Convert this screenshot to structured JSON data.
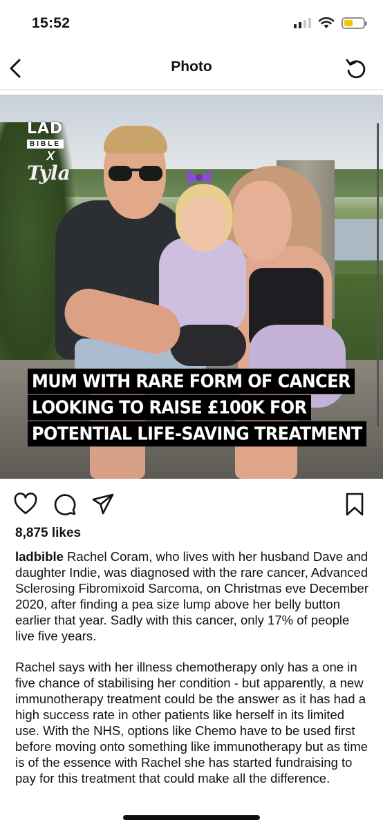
{
  "status_bar": {
    "time": "15:52",
    "battery_level": 0.45,
    "battery_color": "#f6c700",
    "signal_bars": 2
  },
  "nav": {
    "title": "Photo",
    "back_icon": "chevron-left-icon",
    "refresh_icon": "refresh-icon"
  },
  "post": {
    "image": {
      "logo": {
        "lad": "LAD",
        "bible": "BIBLE",
        "x": "X",
        "tyla": "Tyla"
      },
      "headline": [
        "MUM WITH RARE FORM OF CANCER",
        "LOOKING TO RAISE £100K FOR",
        "POTENTIAL LIFE-SAVING TREATMENT"
      ]
    },
    "actions": {
      "like_icon": "heart-icon",
      "comment_icon": "comment-icon",
      "share_icon": "send-icon",
      "save_icon": "bookmark-icon"
    },
    "likes": "8,875 likes",
    "username": "ladbible",
    "caption_p1": "Rachel Coram, who lives with her husband Dave and daughter Indie, was diagnosed with the rare cancer, Advanced Sclerosing Fibromixoid Sarcoma, on Christmas eve December 2020, after finding a pea size lump above her belly button earlier that year. Sadly with this cancer, only 17% of people live five years.",
    "caption_p2": "Rachel says with her illness chemotherapy only has a one in five chance of stabilising her condition - but apparently, a new immunotherapy treatment could be the answer as it has had a high success rate in other patients like herself in its limited use. With the NHS, options like Chemo have to be used first before moving onto something like immunotherapy but as time is of the essence with Rachel she has started fundraising to pay for this treatment that could make all the difference."
  }
}
